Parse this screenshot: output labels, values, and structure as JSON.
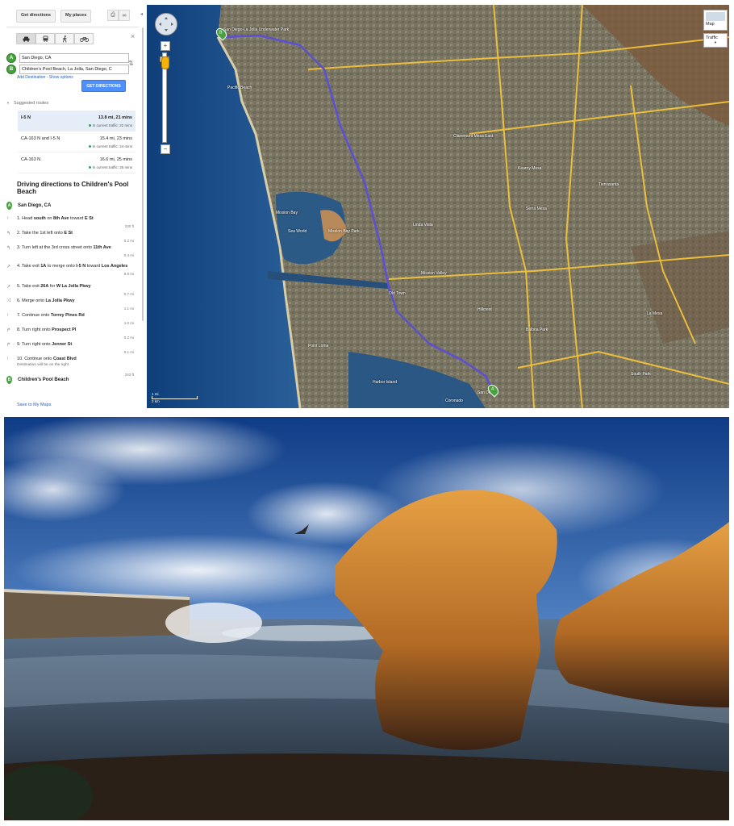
{
  "toolbar": {
    "directions_tab": "Get directions",
    "places_tab": "My places",
    "print_icon": "print-icon",
    "link_icon": "link-icon"
  },
  "travel_modes": [
    "car-icon",
    "transit-icon",
    "walk-icon",
    "bike-icon"
  ],
  "waypoints": [
    {
      "letter": "A",
      "value": "San Diego, CA"
    },
    {
      "letter": "B",
      "value": "Children's Pool Beach, La Jolla, San Diego, C"
    }
  ],
  "links": {
    "add_destination": "Add Destination",
    "sep": " - ",
    "show_options": "Show options"
  },
  "get_directions_button": "GET DIRECTIONS",
  "suggested_title": "Suggested routes",
  "routes": [
    {
      "name": "I-5 N",
      "distance": "13.8 mi, 21 mins",
      "traffic": "In current traffic: 22 mins",
      "selected": true
    },
    {
      "name": "CA-163 N and I-5 N",
      "distance": "15.4 mi, 23 mins",
      "traffic": "In current traffic: 24 mins",
      "selected": false
    },
    {
      "name": "CA-163 N",
      "distance": "16.6 mi, 25 mins",
      "traffic": "In current traffic: 25 mins",
      "selected": false
    }
  ],
  "directions_title": "Driving directions to Children's Pool Beach",
  "origin": {
    "letter": "A",
    "name": "San Diego, CA"
  },
  "steps": [
    {
      "n": "1.",
      "pre": "Head ",
      "b1": "south",
      "mid": " on ",
      "b2": "8th Ave",
      "post": " toward ",
      "b3": "E St",
      "dist": "230 ft",
      "icon": "straight-icon"
    },
    {
      "n": "2.",
      "pre": "Take the 1st left onto ",
      "b1": "E St",
      "mid": "",
      "b2": "",
      "post": "",
      "b3": "",
      "dist": "0.2 mi",
      "icon": "turn-left-icon"
    },
    {
      "n": "3.",
      "pre": "Turn left at the 3rd cross street onto ",
      "b1": "11th Ave",
      "mid": "",
      "b2": "",
      "post": "",
      "b3": "",
      "dist": "0.4 mi",
      "icon": "turn-left-icon"
    },
    {
      "n": "4.",
      "pre": "Take exit ",
      "b1": "1A",
      "mid": " to merge onto ",
      "b2": "I-5 N",
      "post": " toward ",
      "b3": "Los Angeles",
      "dist": "8.8 mi",
      "icon": "ramp-right-icon"
    },
    {
      "n": "5.",
      "pre": "Take exit ",
      "b1": "26A",
      "mid": " for ",
      "b2": "W La Jolla Pkwy",
      "post": "",
      "b3": "",
      "dist": "0.7 mi",
      "icon": "ramp-right-icon"
    },
    {
      "n": "6.",
      "pre": "Merge onto ",
      "b1": "La Jolla Pkwy",
      "mid": "",
      "b2": "",
      "post": "",
      "b3": "",
      "dist": "1.1 mi",
      "icon": "merge-icon"
    },
    {
      "n": "7.",
      "pre": "Continue onto ",
      "b1": "Torrey Pines Rd",
      "mid": "",
      "b2": "",
      "post": "",
      "b3": "",
      "dist": "1.0 mi",
      "icon": "straight-icon"
    },
    {
      "n": "8.",
      "pre": "Turn right onto ",
      "b1": "Prospect Pl",
      "mid": "",
      "b2": "",
      "post": "",
      "b3": "",
      "dist": "0.2 mi",
      "icon": "turn-right-icon"
    },
    {
      "n": "9.",
      "pre": "Turn right onto ",
      "b1": "Jenner St",
      "mid": "",
      "b2": "",
      "post": "",
      "b3": "",
      "dist": "0.1 mi",
      "icon": "turn-right-icon"
    },
    {
      "n": "10.",
      "pre": "Continue onto ",
      "b1": "Coast Blvd",
      "mid": "",
      "b2": "",
      "post": "",
      "b3": "",
      "dist": "243 ft",
      "icon": "straight-icon",
      "sub": "Destination will be on the right"
    }
  ],
  "destination": {
    "letter": "B",
    "name": "Children's Pool Beach"
  },
  "save_link": "Save to My Maps",
  "map": {
    "type_button": "Map",
    "traffic_button": "Traffic",
    "scale_mi": "1 mi",
    "scale_km": "2 km",
    "labels": [
      "San Diego-La Jolla Underwater Park",
      "Mission Bay",
      "Sea World",
      "Mission Bay Park",
      "Old Town",
      "Hillcrest",
      "La Mesa",
      "Clairemont Mesa East",
      "Kearny Mesa",
      "Tierrasanta",
      "Serra Mesa",
      "Linda Vista",
      "Mission Valley",
      "San Diego",
      "Harbor Island",
      "Balboa Park",
      "Coronado",
      "Pacific Beach",
      "South Park",
      "Point Loma"
    ],
    "route_color": "#5b4fd8",
    "highway_color": "#f2c23b"
  },
  "photo": {
    "subject": "sandstone-rock-icon"
  }
}
